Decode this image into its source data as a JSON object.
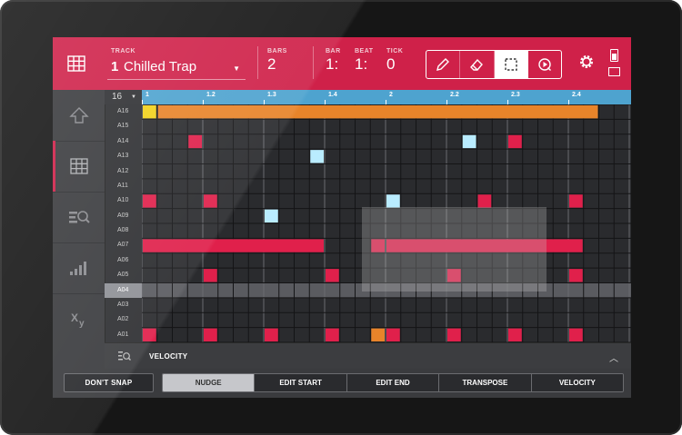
{
  "header": {
    "track_label": "TRACK",
    "track_number": "1",
    "track_name": "Chilled Trap",
    "bars_label": "BARS",
    "bars_value": "2",
    "bar_label": "BAR",
    "bar_value": "1:",
    "beat_label": "BEAT",
    "beat_value": "1:",
    "tick_label": "TICK",
    "tick_value": "0",
    "tools": [
      "pencil-icon",
      "eraser-icon",
      "select-icon",
      "play-icon"
    ],
    "active_tool": "select-icon"
  },
  "sidebar": {
    "items": [
      "arrow-up-icon",
      "grid-icon",
      "zoom-list-icon",
      "bars-icon",
      "xy-icon"
    ],
    "active": "grid-icon"
  },
  "grid": {
    "quantize": "16",
    "ruler_ticks": [
      "1",
      "1.2",
      "1.3",
      "1.4",
      "2",
      "2.2",
      "2.3",
      "2.4"
    ],
    "rows": [
      "A16",
      "A15",
      "A14",
      "A13",
      "A12",
      "A11",
      "A10",
      "A09",
      "A08",
      "A07",
      "A06",
      "A05",
      "A04",
      "A03",
      "A02",
      "A01"
    ],
    "highlight_row": "A04",
    "notes": [
      {
        "row": "A16",
        "start": 0,
        "len": 1,
        "color": "#f2d21b"
      },
      {
        "row": "A16",
        "start": 1,
        "len": 29,
        "color": "#e8842a"
      },
      {
        "row": "A14",
        "start": 3,
        "len": 1,
        "color": "#e0204b"
      },
      {
        "row": "A14",
        "start": 21,
        "len": 1,
        "color": "#b9ecff"
      },
      {
        "row": "A14",
        "start": 24,
        "len": 1,
        "color": "#e0204b"
      },
      {
        "row": "A13",
        "start": 11,
        "len": 1,
        "color": "#b9ecff"
      },
      {
        "row": "A10",
        "start": 0,
        "len": 1,
        "color": "#e0204b"
      },
      {
        "row": "A10",
        "start": 4,
        "len": 1,
        "color": "#e0204b"
      },
      {
        "row": "A10",
        "start": 16,
        "len": 1,
        "color": "#b9ecff"
      },
      {
        "row": "A10",
        "start": 22,
        "len": 1,
        "color": "#e0204b"
      },
      {
        "row": "A10",
        "start": 28,
        "len": 1,
        "color": "#e0204b"
      },
      {
        "row": "A09",
        "start": 8,
        "len": 1,
        "color": "#b9ecff"
      },
      {
        "row": "A07",
        "start": 0,
        "len": 12,
        "color": "#e0204b"
      },
      {
        "row": "A07",
        "start": 15,
        "len": 1,
        "color": "#e0204b"
      },
      {
        "row": "A07",
        "start": 16,
        "len": 13,
        "color": "#e0204b"
      },
      {
        "row": "A05",
        "start": 4,
        "len": 1,
        "color": "#e0204b"
      },
      {
        "row": "A05",
        "start": 12,
        "len": 1,
        "color": "#e0204b"
      },
      {
        "row": "A05",
        "start": 20,
        "len": 1,
        "color": "#e0204b"
      },
      {
        "row": "A05",
        "start": 28,
        "len": 1,
        "color": "#e0204b"
      },
      {
        "row": "A01",
        "start": 0,
        "len": 1,
        "color": "#e0204b"
      },
      {
        "row": "A01",
        "start": 4,
        "len": 1,
        "color": "#e0204b"
      },
      {
        "row": "A01",
        "start": 8,
        "len": 1,
        "color": "#e0204b"
      },
      {
        "row": "A01",
        "start": 12,
        "len": 1,
        "color": "#e0204b"
      },
      {
        "row": "A01",
        "start": 15,
        "len": 1,
        "color": "#e8842a"
      },
      {
        "row": "A01",
        "start": 16,
        "len": 1,
        "color": "#e0204b"
      },
      {
        "row": "A01",
        "start": 20,
        "len": 1,
        "color": "#e0204b"
      },
      {
        "row": "A01",
        "start": 24,
        "len": 1,
        "color": "#e0204b"
      },
      {
        "row": "A01",
        "start": 28,
        "len": 1,
        "color": "#e0204b"
      }
    ]
  },
  "velocity_bar": {
    "label": "VELOCITY"
  },
  "bottom": {
    "snap_label": "DON'T SNAP",
    "modes": [
      "NUDGE",
      "EDIT START",
      "EDIT END",
      "TRANSPOSE",
      "VELOCITY"
    ],
    "active_mode": "NUDGE"
  },
  "colors": {
    "brand": "#cf2149",
    "ruler": "#4ea3cf"
  }
}
